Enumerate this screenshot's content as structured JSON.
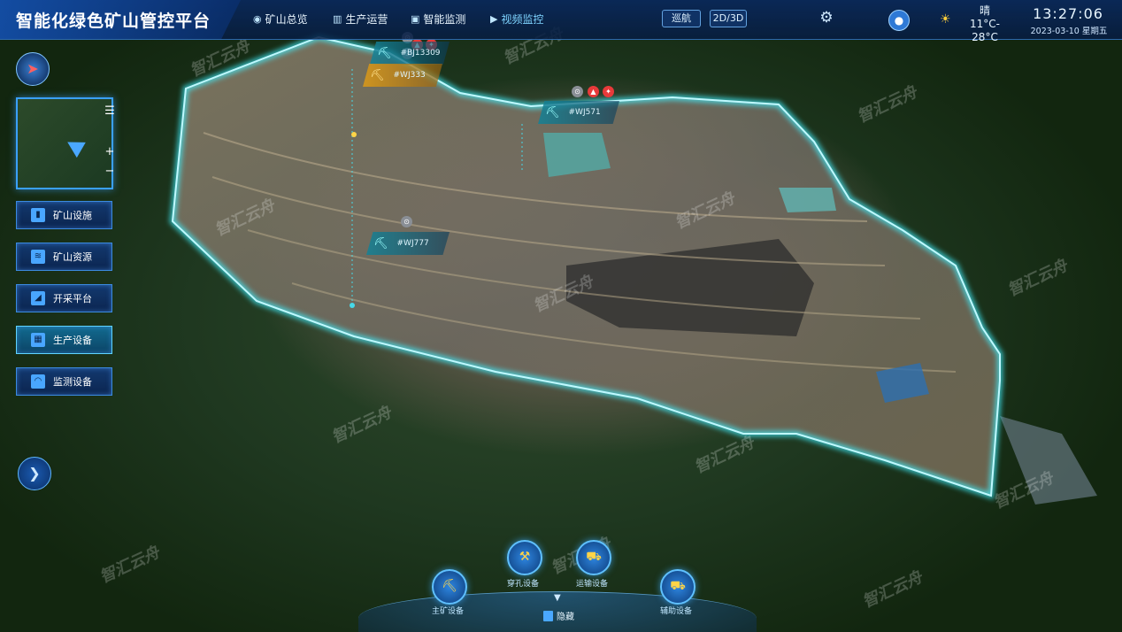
{
  "app": {
    "title": "智能化绿色矿山管控平台"
  },
  "nav": [
    {
      "label": "矿山总览",
      "icon": "globe-icon",
      "glyph": "◉"
    },
    {
      "label": "生产运营",
      "icon": "chart-icon",
      "glyph": "▥"
    },
    {
      "label": "智能监测",
      "icon": "monitor-icon",
      "glyph": "▣"
    },
    {
      "label": "视频监控",
      "icon": "camera-icon",
      "glyph": "▶"
    }
  ],
  "toolbar": {
    "cruise_label": "巡航",
    "view_label": "2D/3D"
  },
  "weather": {
    "condition": "晴",
    "temperature": "11°C-28°C"
  },
  "clock": {
    "time": "13:27:06",
    "date": "2023-03-10 星期五"
  },
  "minimap": {
    "zoom_in": "+",
    "zoom_out": "−",
    "list": "☰"
  },
  "left_menu": [
    {
      "label": "矿山设施",
      "glyph": "▮"
    },
    {
      "label": "矿山资源",
      "glyph": "≋"
    },
    {
      "label": "开采平台",
      "glyph": "◢"
    },
    {
      "label": "生产设备",
      "glyph": "▦"
    },
    {
      "label": "监测设备",
      "glyph": "◠"
    }
  ],
  "markers": [
    {
      "code": "#BJ13309"
    },
    {
      "code": "#WJ333"
    },
    {
      "code": "#WJ571"
    },
    {
      "code": "#WJ777"
    }
  ],
  "dock": [
    {
      "label": "主矿设备",
      "icon": "excavator-icon"
    },
    {
      "label": "穿孔设备",
      "icon": "drill-icon"
    },
    {
      "label": "运输设备",
      "icon": "dump-truck-icon"
    },
    {
      "label": "辅助设备",
      "icon": "service-truck-icon"
    }
  ],
  "hide_label": "隐藏",
  "watermark": "智汇云舟",
  "colors": {
    "accent": "#3aa0ff",
    "boundary": "#3ff0ff",
    "alert": "#e83a3a"
  }
}
